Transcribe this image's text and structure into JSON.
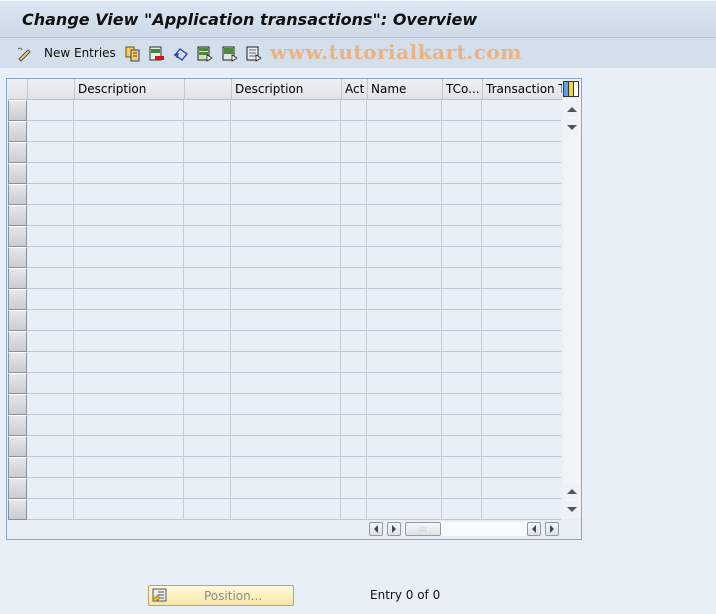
{
  "window": {
    "title": "Change View \"Application transactions\": Overview"
  },
  "toolbar": {
    "new_entries_label": "New Entries",
    "icons": [
      "edit-pencil-icon",
      "copy-icon",
      "delete-icon",
      "undo-change-icon",
      "select-all-icon",
      "select-block-icon",
      "deselect-all-icon"
    ],
    "watermark": "www.tutorialkart.com"
  },
  "table": {
    "columns": [
      {
        "label": ""
      },
      {
        "label": "Description"
      },
      {
        "label": ""
      },
      {
        "label": "Description"
      },
      {
        "label": "Act"
      },
      {
        "label": "Name"
      },
      {
        "label": "TCo..."
      },
      {
        "label": "Transaction Te"
      }
    ],
    "visible_empty_rows": 20,
    "rows": []
  },
  "footer": {
    "position_button_label": "Position...",
    "entry_status": "Entry 0 of 0"
  }
}
